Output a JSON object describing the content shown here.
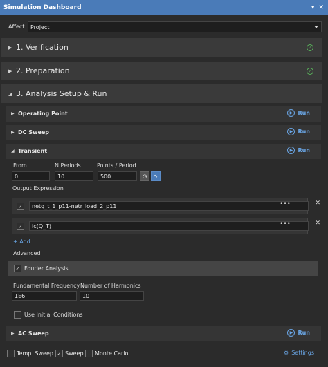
{
  "window": {
    "title": "Simulation Dashboard",
    "pin_icon": "pin-icon",
    "close_icon": "close-icon"
  },
  "affect": {
    "label": "Affect",
    "value": "Project"
  },
  "sections": [
    {
      "label": "1. Verification",
      "status": "check-circle-icon"
    },
    {
      "label": "2. Preparation",
      "status": "check-circle-icon"
    },
    {
      "label": "3. Analysis Setup & Run"
    }
  ],
  "analyses": {
    "operating_point": {
      "label": "Operating Point",
      "run": "Run"
    },
    "dc_sweep": {
      "label": "DC Sweep",
      "run": "Run"
    },
    "transient": {
      "label": "Transient",
      "run": "Run",
      "from_label": "From",
      "from_value": "0",
      "n_periods_label": "N Periods",
      "n_periods_value": "10",
      "points_label": "Points / Period",
      "points_value": "500",
      "output_expression_label": "Output Expression",
      "expressions": [
        {
          "value": "netq_t_1_p11-netr_load_2_p11",
          "checked": true
        },
        {
          "value": "ic(Q_T)",
          "checked": true
        }
      ],
      "more_label": "•••",
      "add_label": "+ Add",
      "advanced_label": "Advanced",
      "fourier_label": "Fourier Analysis",
      "fundamental_label": "Fundamental Frequency",
      "fundamental_value": "1E6",
      "harmonics_label": "Number of Harmonics",
      "harmonics_value": "10",
      "use_ic_label": "Use Initial Conditions"
    },
    "ac_sweep": {
      "label": "AC Sweep",
      "run": "Run"
    }
  },
  "footer": {
    "temp_sweep": "Temp. Sweep",
    "sweep": "Sweep",
    "monte_carlo": "Monte Carlo",
    "settings": "Settings"
  },
  "colors": {
    "accent": "#4a7bb8",
    "link": "#6aa6e6",
    "success": "#59b25b"
  }
}
